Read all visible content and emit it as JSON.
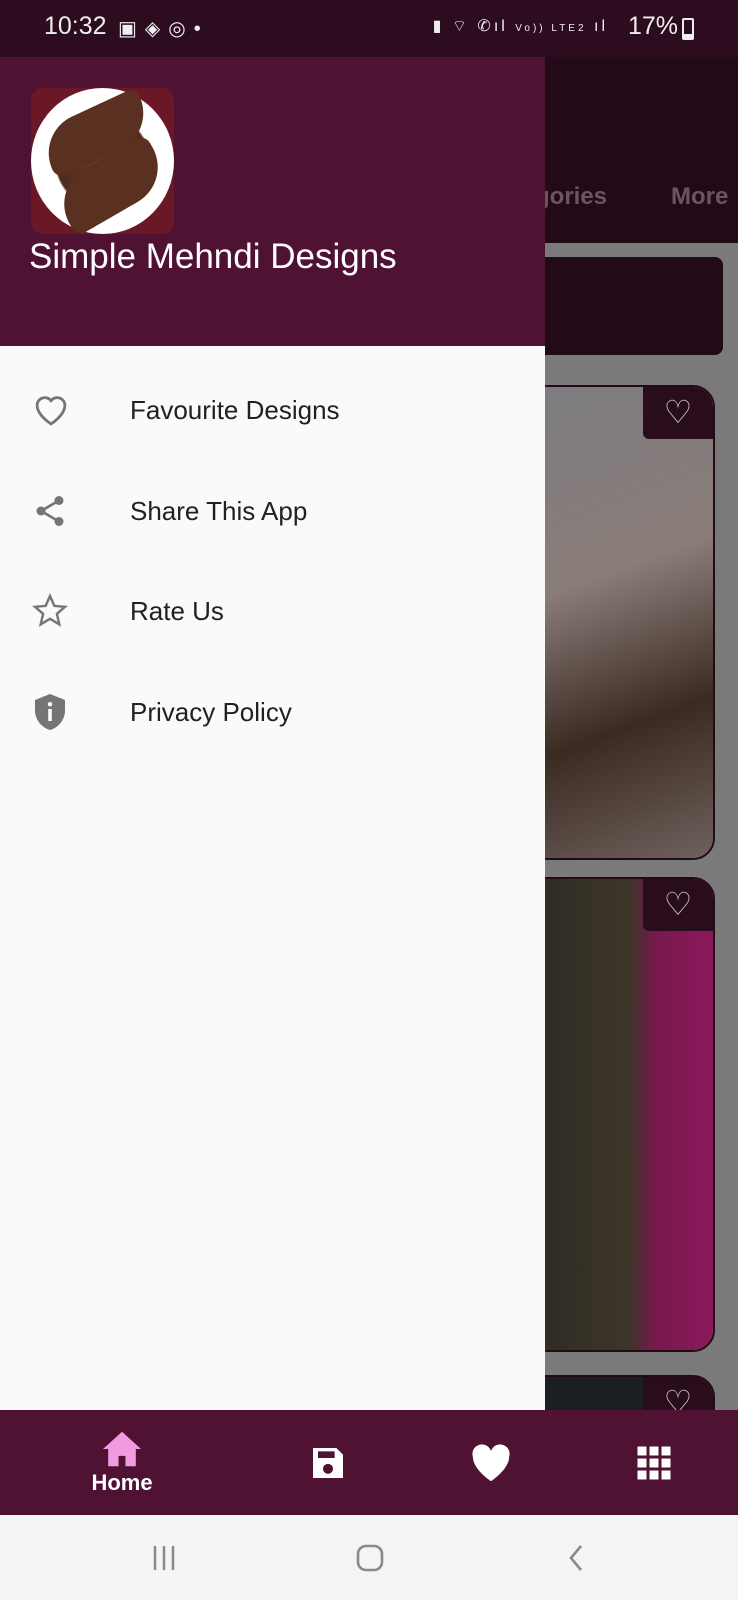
{
  "status_bar": {
    "time": "10:32",
    "battery": "17%",
    "network_label": "Vo)) LTE2"
  },
  "background_app": {
    "tabs": [
      "gories",
      "More"
    ]
  },
  "drawer": {
    "app_title": "Simple Mehndi Designs",
    "items": [
      {
        "label": "Favourite Designs",
        "icon": "heart-outline-icon"
      },
      {
        "label": "Share This App",
        "icon": "share-icon"
      },
      {
        "label": "Rate Us",
        "icon": "star-outline-icon"
      },
      {
        "label": "Privacy Policy",
        "icon": "shield-info-icon"
      }
    ]
  },
  "bottom_nav": {
    "items": [
      {
        "label": "Home",
        "icon": "home-icon",
        "active": true
      },
      {
        "label": "",
        "icon": "save-icon"
      },
      {
        "label": "",
        "icon": "heart-icon"
      },
      {
        "label": "",
        "icon": "grid-icon"
      }
    ],
    "active_color": "#f29ae0",
    "background": "#4f1232"
  },
  "colors": {
    "primary": "#4f1232",
    "status_bar": "#2e0c1f",
    "drawer_bg": "#fafafa"
  }
}
